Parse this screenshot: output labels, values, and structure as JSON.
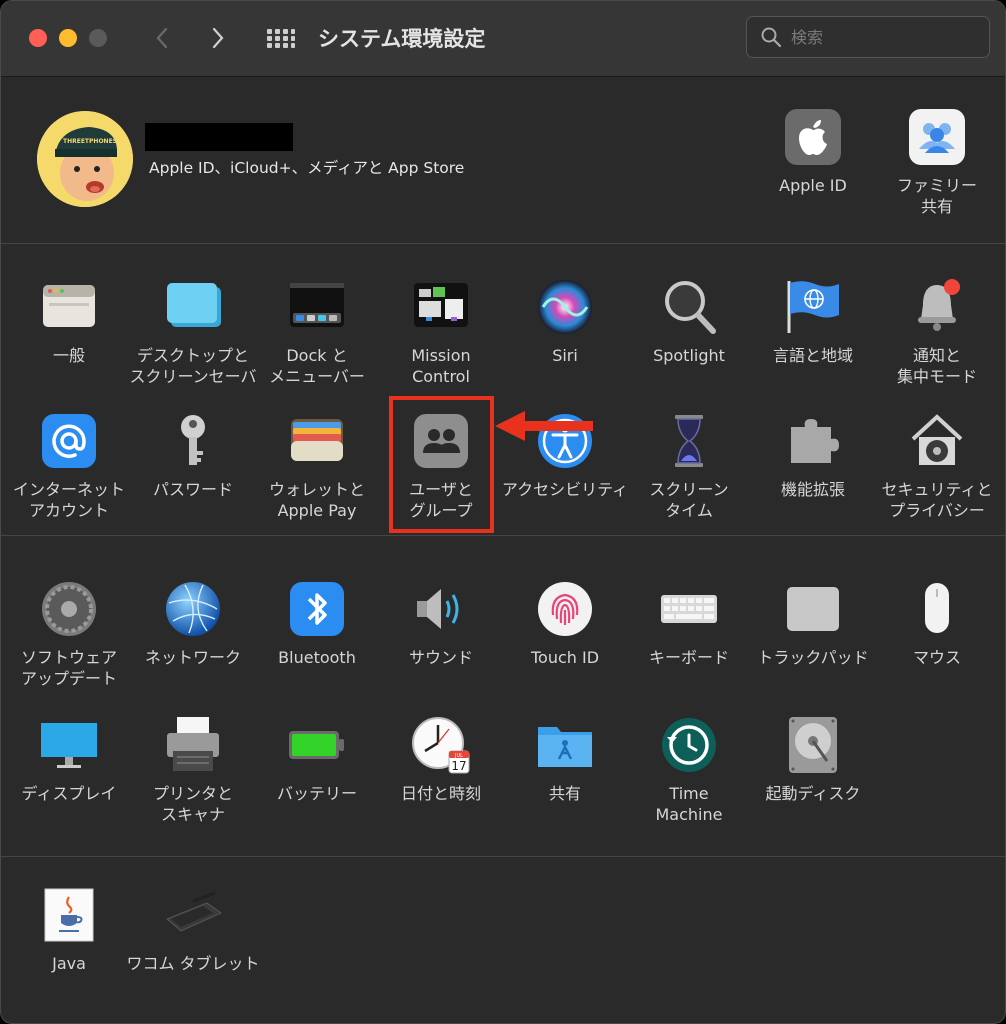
{
  "window": {
    "title": "システム環境設定",
    "search_placeholder": "検索"
  },
  "account": {
    "subtitle": "Apple ID、iCloud+、メディアと App Store",
    "avatar_cap_text": "THREETPHONES",
    "apple_id_label": "Apple ID",
    "family_label": "ファミリー\n共有"
  },
  "row1": [
    {
      "label": "一般",
      "icon": "general-icon"
    },
    {
      "label": "デスクトップと\nスクリーンセーバ",
      "icon": "desktop-icon"
    },
    {
      "label": "Dock と\nメニューバー",
      "icon": "dock-icon"
    },
    {
      "label": "Mission\nControl",
      "icon": "mission-control-icon"
    },
    {
      "label": "Siri",
      "icon": "siri-icon"
    },
    {
      "label": "Spotlight",
      "icon": "spotlight-icon"
    },
    {
      "label": "言語と地域",
      "icon": "language-flag-icon"
    },
    {
      "label": "通知と\n集中モード",
      "icon": "notification-bell-icon"
    }
  ],
  "row2": [
    {
      "label": "インターネット\nアカウント",
      "icon": "at-sign-icon"
    },
    {
      "label": "パスワード",
      "icon": "key-icon"
    },
    {
      "label": "ウォレットと\nApple Pay",
      "icon": "wallet-icon"
    },
    {
      "label": "ユーザと\nグループ",
      "icon": "users-icon"
    },
    {
      "label": "アクセシビリティ",
      "icon": "accessibility-icon"
    },
    {
      "label": "スクリーン\nタイム",
      "icon": "hourglass-icon"
    },
    {
      "label": "機能拡張",
      "icon": "puzzle-icon"
    },
    {
      "label": "セキュリティと\nプライバシー",
      "icon": "house-lock-icon"
    }
  ],
  "row3": [
    {
      "label": "ソフトウェア\nアップデート",
      "icon": "gear-icon"
    },
    {
      "label": "ネットワーク",
      "icon": "globe-icon"
    },
    {
      "label": "Bluetooth",
      "icon": "bluetooth-icon"
    },
    {
      "label": "サウンド",
      "icon": "speaker-icon"
    },
    {
      "label": "Touch ID",
      "icon": "fingerprint-icon"
    },
    {
      "label": "キーボード",
      "icon": "keyboard-icon"
    },
    {
      "label": "トラックパッド",
      "icon": "trackpad-icon"
    },
    {
      "label": "マウス",
      "icon": "mouse-icon"
    }
  ],
  "row4": [
    {
      "label": "ディスプレイ",
      "icon": "display-icon"
    },
    {
      "label": "プリンタと\nスキャナ",
      "icon": "printer-icon"
    },
    {
      "label": "バッテリー",
      "icon": "battery-icon"
    },
    {
      "label": "日付と時刻",
      "icon": "clock-icon"
    },
    {
      "label": "共有",
      "icon": "shared-folder-icon"
    },
    {
      "label": "Time\nMachine",
      "icon": "time-machine-icon"
    },
    {
      "label": "起動ディスク",
      "icon": "hard-disk-icon"
    }
  ],
  "row5": [
    {
      "label": "Java",
      "icon": "java-icon"
    },
    {
      "label": "ワコム タブレット",
      "icon": "wacom-tablet-icon"
    }
  ],
  "calendar": {
    "month": "JUL",
    "day": "17"
  },
  "colors": {
    "close": "#ff5f57",
    "minimize": "#febc2e",
    "zoom": "#5a5a5a",
    "highlight": "#e8321e",
    "window_bg": "#2a2a2a"
  }
}
